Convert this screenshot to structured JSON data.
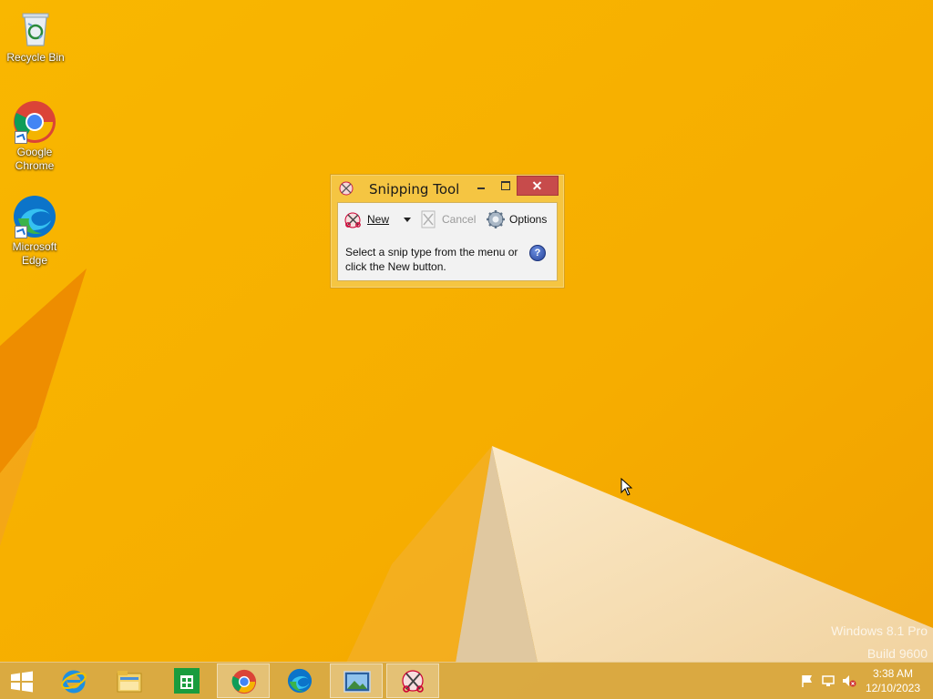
{
  "desktop": {
    "icons": [
      {
        "label": "Recycle Bin",
        "icon": "recycle-bin-icon"
      },
      {
        "label": "Google Chrome",
        "icon": "chrome-icon"
      },
      {
        "label": "Microsoft Edge",
        "icon": "edge-icon"
      }
    ],
    "watermark": {
      "line1": "Windows 8.1 Pro",
      "line2": "Build 9600"
    }
  },
  "snipping_tool": {
    "title": "Snipping Tool",
    "toolbar": {
      "new_label": "New",
      "cancel_label": "Cancel",
      "options_label": "Options"
    },
    "message": "Select a snip type from the menu or click the New button.",
    "help_glyph": "?"
  },
  "taskbar": {
    "items": [
      {
        "icon": "windows-start-icon"
      },
      {
        "icon": "internet-explorer-icon"
      },
      {
        "icon": "file-explorer-icon"
      },
      {
        "icon": "store-icon"
      },
      {
        "icon": "chrome-icon",
        "active": true
      },
      {
        "icon": "edge-icon"
      },
      {
        "icon": "photos-icon",
        "active": true
      },
      {
        "icon": "snipping-tool-icon",
        "active": true
      }
    ],
    "tray": {
      "time": "3:38 AM",
      "date": "12/10/2023"
    }
  },
  "colors": {
    "wallpaper": "#f7b500",
    "window_frame": "#f5c542",
    "close_button": "#c74b4b",
    "taskbar": "#d6aa4a"
  }
}
